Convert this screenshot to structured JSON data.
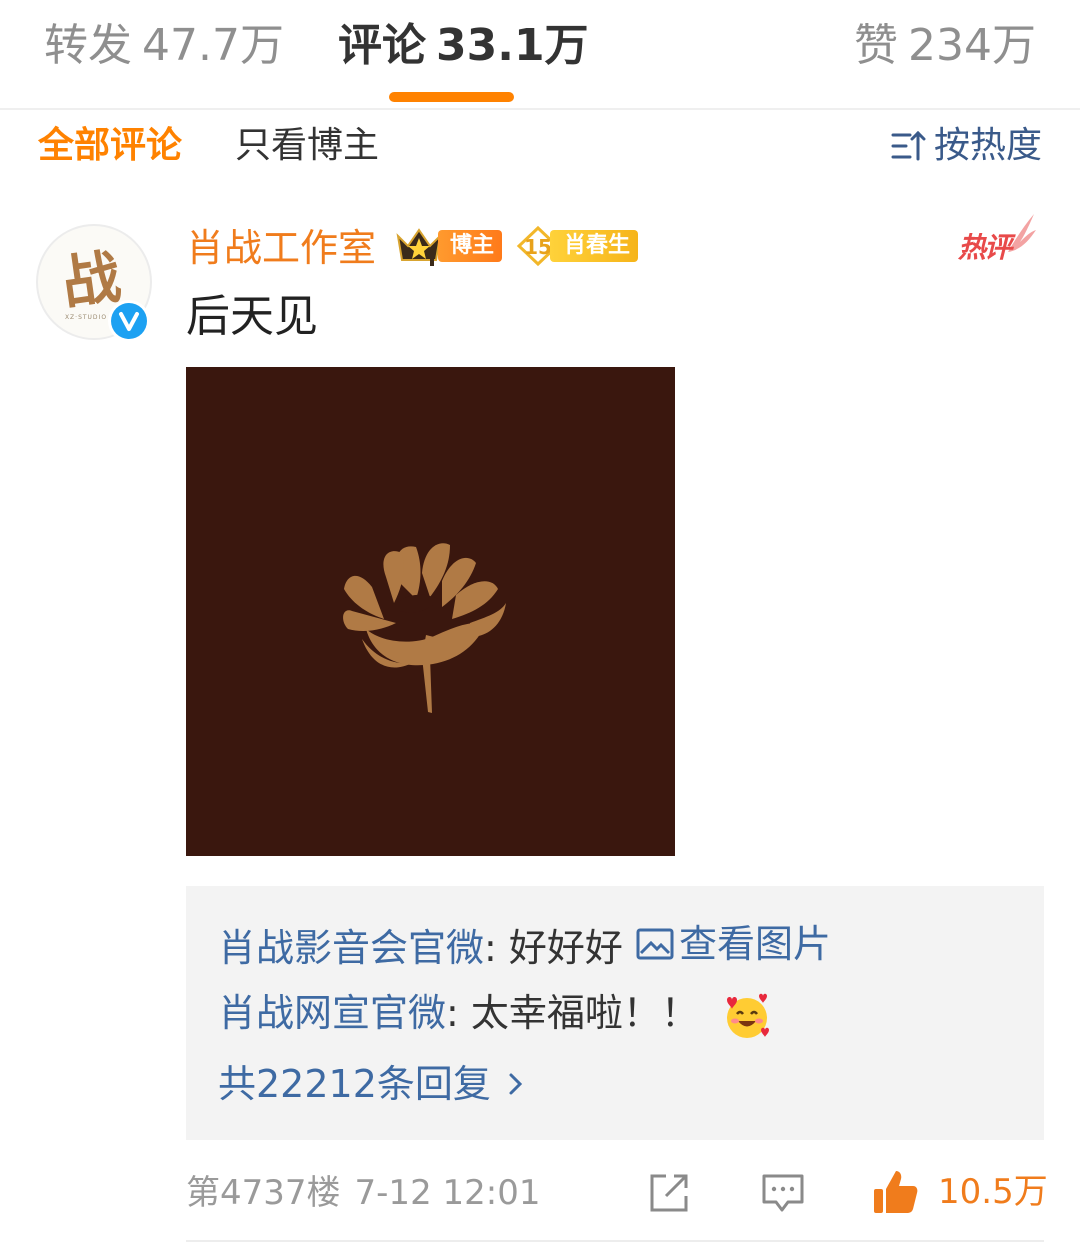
{
  "tabs": {
    "repost": {
      "label": "转发",
      "count": "47.7万"
    },
    "comment": {
      "label": "评论",
      "count": "33.1万"
    },
    "like": {
      "label": "赞",
      "count": "234万"
    },
    "active": "comment"
  },
  "filter": {
    "all_label": "全部评论",
    "blogger_only_label": "只看博主",
    "sort_label": "按热度",
    "sort_icon": "sort-icon"
  },
  "comment": {
    "author": "肖战工作室",
    "avatar_char": "战",
    "avatar_sub": "XZ·STUDIO",
    "blogger_badge": "博主",
    "fan_level": "15",
    "fan_badge": "肖春生",
    "hot_label": "热评",
    "text": "后天见",
    "image": "flower-image",
    "replies": [
      {
        "author": "肖战影音会官微",
        "sep": ": ",
        "text": "好好好",
        "link": "查看图片"
      },
      {
        "author": "肖战网宣官微",
        "sep": ": ",
        "text": "太幸福啦！！",
        "emoji": "smiling-face-with-hearts"
      }
    ],
    "more_replies": "共22212条回复",
    "floor": "第4737楼",
    "time": "7-12 12:01",
    "like_count": "10.5万"
  },
  "colors": {
    "accent": "#ff8200",
    "link": "#3e6aa3",
    "author": "#f07c1c",
    "photo_bg": "#3a170e",
    "flower": "#b07a45",
    "hot": "#e84a4a",
    "verified": "#1da1f2"
  }
}
